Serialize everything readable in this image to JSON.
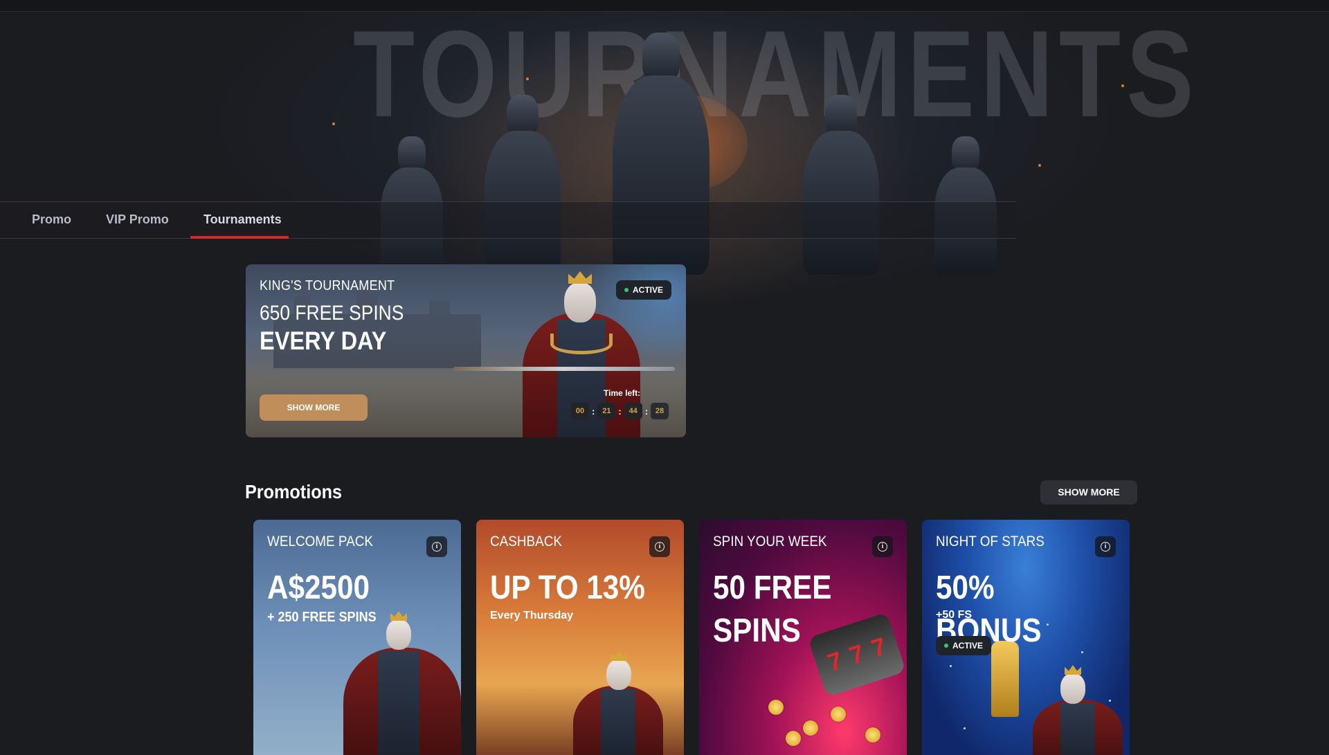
{
  "hero": {
    "word": "TOURNAMENTS"
  },
  "tabs": [
    {
      "label": "Promo"
    },
    {
      "label": "VIP Promo"
    },
    {
      "label": "Tournaments"
    }
  ],
  "active_tab": "Tournaments",
  "tournament": {
    "title": "KING'S TOURNAMENT",
    "subtitle": "650 FREE SPINS",
    "headline": "EVERY DAY",
    "button": "SHOW MORE",
    "status": "ACTIVE",
    "time_left_label": "Time left:",
    "timer": [
      "00",
      "21",
      "44",
      "28"
    ],
    "timer_sep": ":"
  },
  "promotions": {
    "heading": "Promotions",
    "show_more": "SHOW MORE",
    "cards": [
      {
        "title": "WELCOME PACK",
        "value": "A$2500",
        "extra": "+ 250 FREE SPINS"
      },
      {
        "title": "CASHBACK",
        "value": "UP TO 13%",
        "extra": "Every Thursday"
      },
      {
        "title": "SPIN YOUR WEEK",
        "value_line1": "50 FREE",
        "value_line2": "SPINS"
      },
      {
        "title": "NIGHT OF STARS",
        "value": "50% BONUS",
        "extra": "+50 FS",
        "status": "ACTIVE"
      }
    ]
  },
  "icons": {
    "info": "info-icon",
    "status_dot": "status-dot-icon"
  },
  "colors": {
    "background": "#1b1c20",
    "tab_underline": "#d3272e",
    "show_more_button": "#c08e5a",
    "active_dot": "#3ec46d",
    "timer_digits": "#d4a44e"
  }
}
